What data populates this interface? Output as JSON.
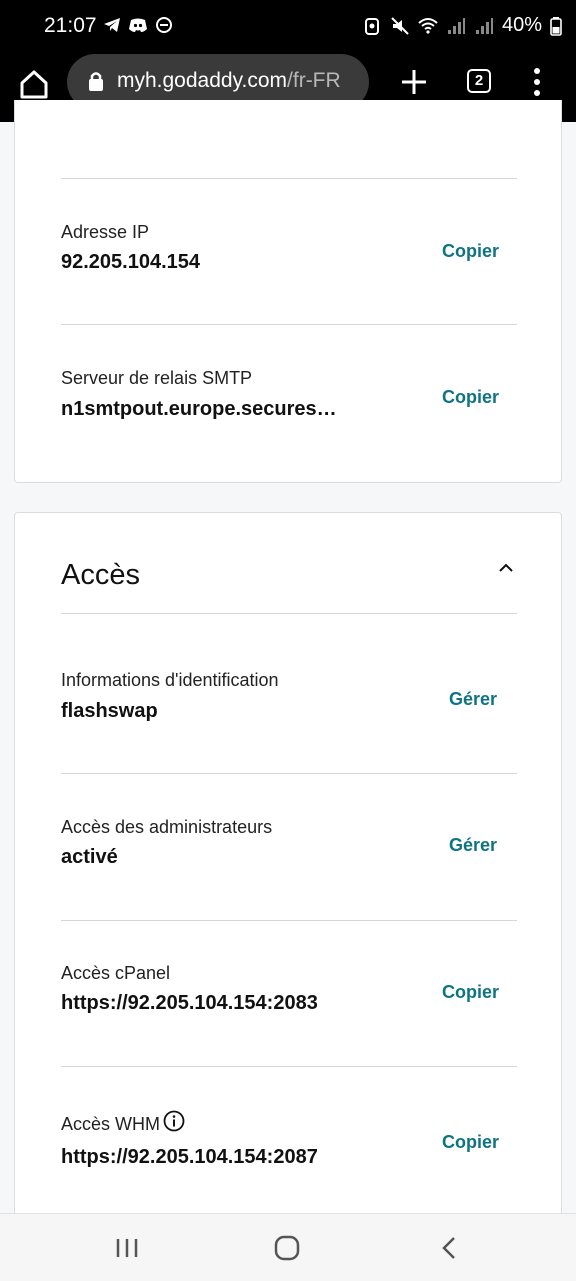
{
  "status_bar": {
    "time": "21:07",
    "battery": "40%",
    "icons": [
      "telegram-icon",
      "discord-icon",
      "dnd-icon",
      "nfc-icon",
      "mute-icon",
      "wifi-icon",
      "signal-icon",
      "signal-icon",
      "battery-icon"
    ]
  },
  "browser": {
    "url_host": "myh.godaddy.com",
    "url_path": "/fr-FR",
    "tab_count": "2"
  },
  "server_card": {
    "rows": [
      {
        "label": "Adresse IP",
        "value": "92.205.104.154",
        "action": "Copier"
      },
      {
        "label": "Serveur de relais SMTP",
        "value": "n1smtpout.europe.secures…",
        "action": "Copier"
      }
    ]
  },
  "access_card": {
    "title": "Accès",
    "rows": [
      {
        "label": "Informations d'identification",
        "value": "flashswap",
        "action": "Gérer"
      },
      {
        "label": "Accès des administrateurs",
        "value": "activé",
        "action": "Gérer"
      },
      {
        "label": "Accès cPanel",
        "value": "https://92.205.104.154:2083",
        "action": "Copier"
      },
      {
        "label": "Accès WHM",
        "value": "https://92.205.104.154:2087",
        "action": "Copier"
      }
    ]
  },
  "colors": {
    "accent": "#0f7482",
    "chrome": "#000000",
    "page_bg": "#f5f7f8"
  }
}
